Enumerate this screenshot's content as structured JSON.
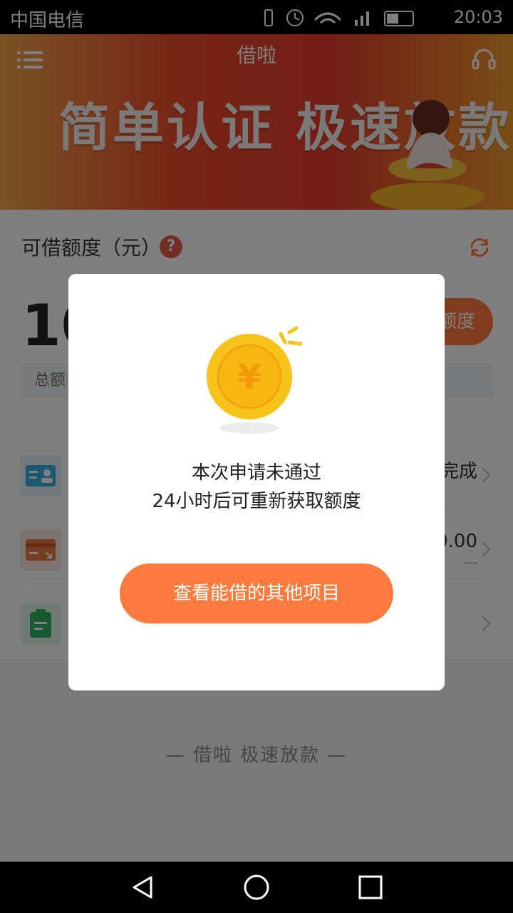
{
  "status_bar": {
    "carrier": "中国电信",
    "time": "20:03"
  },
  "header": {
    "title": "借啦"
  },
  "banner": {
    "slogan": "简单认证 极速放款"
  },
  "credit": {
    "label": "可借额度（元）",
    "amount": "10",
    "quota_button": "额度",
    "total_label": "总额"
  },
  "list": {
    "row1_value": "完成",
    "row2_value": "0.00",
    "row2_sub": "---"
  },
  "footer": {
    "slogan": "— 借啦  极速放款 —"
  },
  "modal": {
    "message_line1": "本次申请未通过",
    "message_line2": "24小时后可重新获取额度",
    "cta_label": "查看能借的其他项目",
    "coin_symbol": "¥"
  },
  "colors": {
    "accent": "#ff7a3d",
    "banner_red": "#e63d2c",
    "coin": "#f7c21a"
  },
  "icons": [
    "menu-icon",
    "headset-icon",
    "help-icon",
    "refresh-icon",
    "id-card-icon",
    "bank-card-icon",
    "clipboard-icon",
    "chevron-right-icon",
    "back-icon",
    "home-icon",
    "recents-icon",
    "coin-icon"
  ]
}
